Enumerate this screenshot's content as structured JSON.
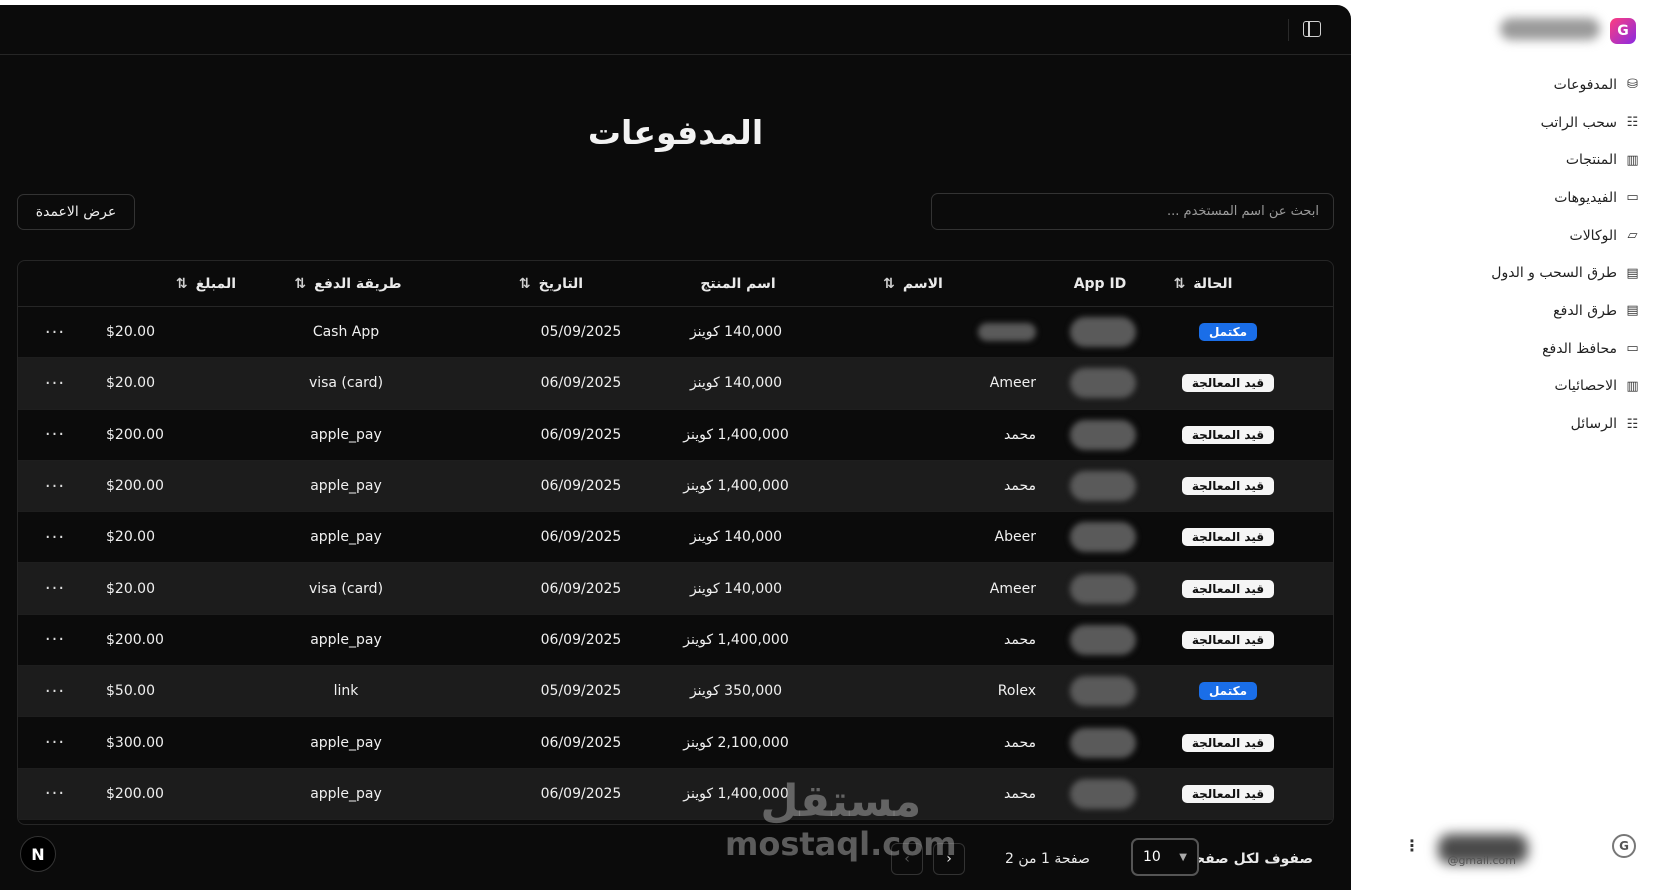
{
  "page": {
    "title": "المدفوعات",
    "columns_button": "عرض الاعمدة",
    "search_placeholder": "ابحث عن اسم المستخدم ..."
  },
  "table": {
    "headers": {
      "status": "الحالة",
      "app_id": "App ID",
      "name": "الاسم",
      "product": "اسم المنتج",
      "date": "التاريخ",
      "method": "طريقة الدفع",
      "amount": "المبلغ"
    },
    "rows": [
      {
        "status": "مكتمل",
        "status_type": "done",
        "name": "",
        "product": "140,000 كوينز",
        "date": "05/09/2025",
        "method": "Cash App",
        "amount": "$20.00"
      },
      {
        "status": "قيد المعالجة",
        "status_type": "pending",
        "name": "Ameer",
        "product": "140,000 كوينز",
        "date": "06/09/2025",
        "method": "visa (card)",
        "amount": "$20.00"
      },
      {
        "status": "قيد المعالجة",
        "status_type": "pending",
        "name": "محمد",
        "product": "1,400,000 كوينز",
        "date": "06/09/2025",
        "method": "apple_pay",
        "amount": "$200.00"
      },
      {
        "status": "قيد المعالجة",
        "status_type": "pending",
        "name": "محمد",
        "product": "1,400,000 كوينز",
        "date": "06/09/2025",
        "method": "apple_pay",
        "amount": "$200.00"
      },
      {
        "status": "قيد المعالجة",
        "status_type": "pending",
        "name": "Abeer",
        "product": "140,000 كوينز",
        "date": "06/09/2025",
        "method": "apple_pay",
        "amount": "$20.00"
      },
      {
        "status": "قيد المعالجة",
        "status_type": "pending",
        "name": "Ameer",
        "product": "140,000 كوينز",
        "date": "06/09/2025",
        "method": "visa (card)",
        "amount": "$20.00"
      },
      {
        "status": "قيد المعالجة",
        "status_type": "pending",
        "name": "محمد",
        "product": "1,400,000 كوينز",
        "date": "06/09/2025",
        "method": "apple_pay",
        "amount": "$200.00"
      },
      {
        "status": "مكتمل",
        "status_type": "done",
        "name": "Rolex",
        "product": "350,000 كوينز",
        "date": "05/09/2025",
        "method": "link",
        "amount": "$50.00"
      },
      {
        "status": "قيد المعالجة",
        "status_type": "pending",
        "name": "محمد",
        "product": "2,100,000 كوينز",
        "date": "06/09/2025",
        "method": "apple_pay",
        "amount": "$300.00"
      },
      {
        "status": "قيد المعالجة",
        "status_type": "pending",
        "name": "محمد",
        "product": "1,400,000 كوينز",
        "date": "06/09/2025",
        "method": "apple_pay",
        "amount": "$200.00"
      }
    ],
    "row_actions_icon": "···"
  },
  "pagination": {
    "rows_per_page_label": "صفوف لكل صفحة",
    "rows_per_page_value": "10",
    "page_label": "صفحة 1 من 2",
    "next": "›",
    "prev": "‹"
  },
  "corner_badge": "N",
  "watermark": {
    "arabic": "مستقل",
    "latin": "mostaql.com"
  },
  "sidebar": {
    "items": [
      {
        "label": "المدفوعات",
        "icon": "coin-hand-icon",
        "glyph": "⛁"
      },
      {
        "label": "سحب الراتب",
        "icon": "list-icon",
        "glyph": "☷"
      },
      {
        "label": "المنتجات",
        "icon": "chart-icon",
        "glyph": "▥"
      },
      {
        "label": "الفيديوهات",
        "icon": "video-icon",
        "glyph": "▭"
      },
      {
        "label": "الوكالات",
        "icon": "folder-icon",
        "glyph": "▱"
      },
      {
        "label": "طرق السحب و الدول",
        "icon": "wallet-icon",
        "glyph": "▤"
      },
      {
        "label": "طرق الدفع",
        "icon": "wallet-icon",
        "glyph": "▤"
      },
      {
        "label": "محافظ الدفع",
        "icon": "card-icon",
        "glyph": "▭"
      },
      {
        "label": "الاحصائيات",
        "icon": "chart-icon",
        "glyph": "▥"
      },
      {
        "label": "الرسائل",
        "icon": "list-icon",
        "glyph": "☷"
      }
    ],
    "brand_glyph": "G",
    "user_email": "@gmail.com",
    "user_menu_icon": "⋮"
  },
  "colors": {
    "accent_done": "#1a6ee8",
    "pending_bg": "#f5f5f5",
    "panel_bg": "#0b0b0b",
    "alt_row": "#1c1c1c"
  }
}
